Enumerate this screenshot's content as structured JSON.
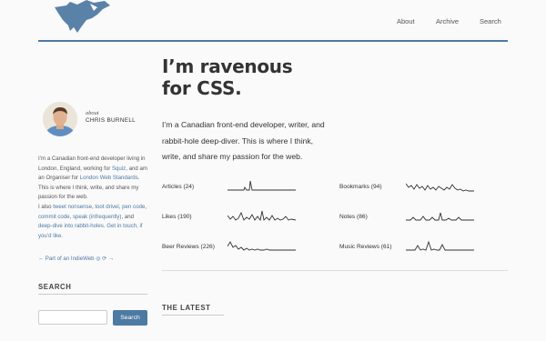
{
  "nav": {
    "about": "About",
    "archive": "Archive",
    "search": "Search"
  },
  "hero": {
    "line1": "I’m ravenous",
    "line2": "for CSS."
  },
  "intro": {
    "line1": "I’m a Canadian front-end developer, writer, and",
    "line2": "rabbit-hole deep-diver. This is where I think,",
    "line3": "write, and share my passion for the web."
  },
  "stats": {
    "articles": "Articles (24)",
    "bookmarks": "Bookmarks (94)",
    "likes": "Likes (190)",
    "notes": "Notes (86)",
    "beer_reviews": "Beer Reviews (226)",
    "music_reviews": "Music Reviews (61)"
  },
  "latest_heading": "THE LATEST",
  "sidebar": {
    "about_label": "about",
    "about_name": "CHRIS BURNELL",
    "bio": {
      "t1": "I’m a Canadian front-end developer living in London, England, working for ",
      "squiz": "Squiz",
      "t2": ", and am an Organiser for ",
      "lws": "London Web Standards",
      "t3": ". This is where I think, write, and share my passion for the web.",
      "t4": "I also ",
      "tweet": "tweet nonsense",
      "c1": ", ",
      "toot": "toot drivel",
      "c2": ", ",
      "pen": "pen code",
      "c3": ", ",
      "commit": "commit code",
      "c4": ", ",
      "speak": "speak (infrequently)",
      "c5": ", and ",
      "deepdive": "deep-dive into rabbit-holes",
      "c6": ". ",
      "touch": "Get in touch, if you’d like."
    },
    "indieweb": "← Part of an IndieWeb ◎ ⟳ →",
    "search_heading": "SEARCH",
    "search_button": "Search",
    "search_placeholder": ""
  },
  "colors": {
    "accent": "#4d7aa3",
    "text": "#333333",
    "background": "#fafafa"
  }
}
